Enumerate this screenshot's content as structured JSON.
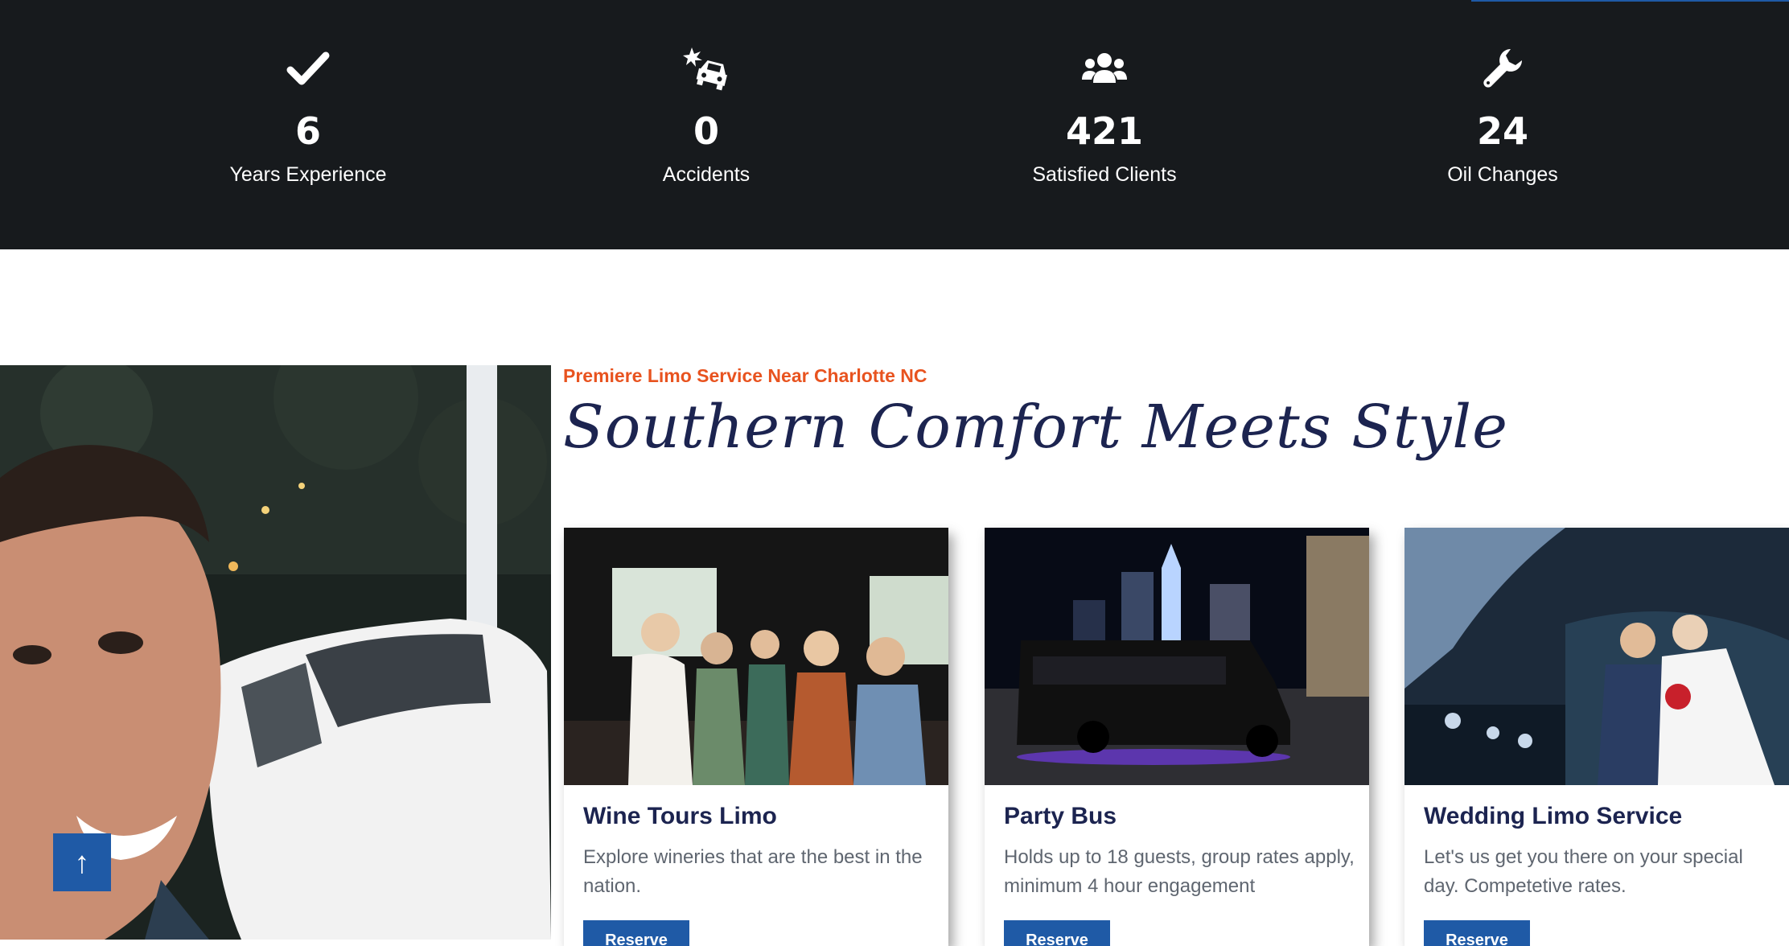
{
  "stats": [
    {
      "icon": "check-icon",
      "value": "6",
      "label": "Years Experience"
    },
    {
      "icon": "car-crash-icon",
      "value": "0",
      "label": "Accidents"
    },
    {
      "icon": "users-icon",
      "value": "421",
      "label": "Satisfied Clients"
    },
    {
      "icon": "wrench-icon",
      "value": "24",
      "label": "Oil Changes"
    }
  ],
  "intro": {
    "eyebrow": "Premiere Limo Service Near Charlotte NC",
    "headline": "Southern Comfort Meets Style"
  },
  "back_to_top": "↑",
  "cards": [
    {
      "title": "Wine Tours Limo",
      "description": "Explore wineries that are the best in the nation.",
      "button": "Reserve"
    },
    {
      "title": "Party Bus",
      "description": "Holds up to 18 guests, group rates apply, minimum 4 hour engagement",
      "button": "Reserve"
    },
    {
      "title": "Wedding Limo Service",
      "description": "Let's us get you there on your special day. Competetive rates.",
      "button": "Reserve"
    }
  ],
  "colors": {
    "stats_bg": "#171a1d",
    "accent_orange": "#e8531f",
    "navy": "#1c2450",
    "button_blue": "#1f5aa6"
  }
}
